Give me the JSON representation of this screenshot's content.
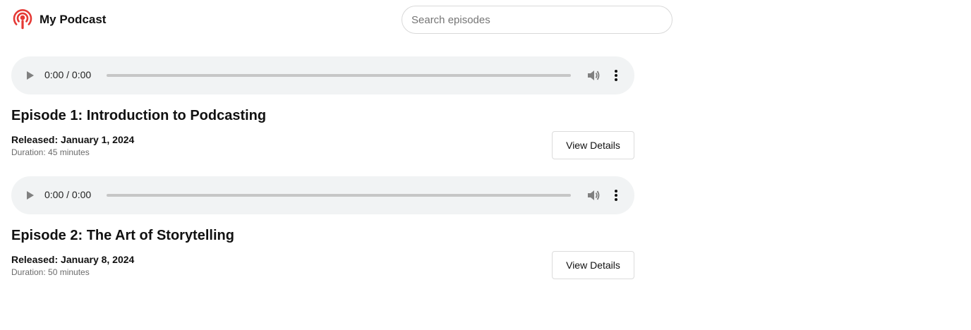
{
  "header": {
    "brand": "My Podcast",
    "logo_icon": "podcast-icon",
    "logo_color": "#e53935",
    "search": {
      "placeholder": "Search episodes",
      "value": ""
    }
  },
  "episodes": [
    {
      "player": {
        "time": "0:00 / 0:00",
        "progress": 0
      },
      "title": "Episode 1: Introduction to Podcasting",
      "released": "Released: January 1, 2024",
      "duration": "Duration: 45 minutes",
      "button": "View Details"
    },
    {
      "player": {
        "time": "0:00 / 0:00",
        "progress": 0
      },
      "title": "Episode 2: The Art of Storytelling",
      "released": "Released: January 8, 2024",
      "duration": "Duration: 50 minutes",
      "button": "View Details"
    }
  ]
}
